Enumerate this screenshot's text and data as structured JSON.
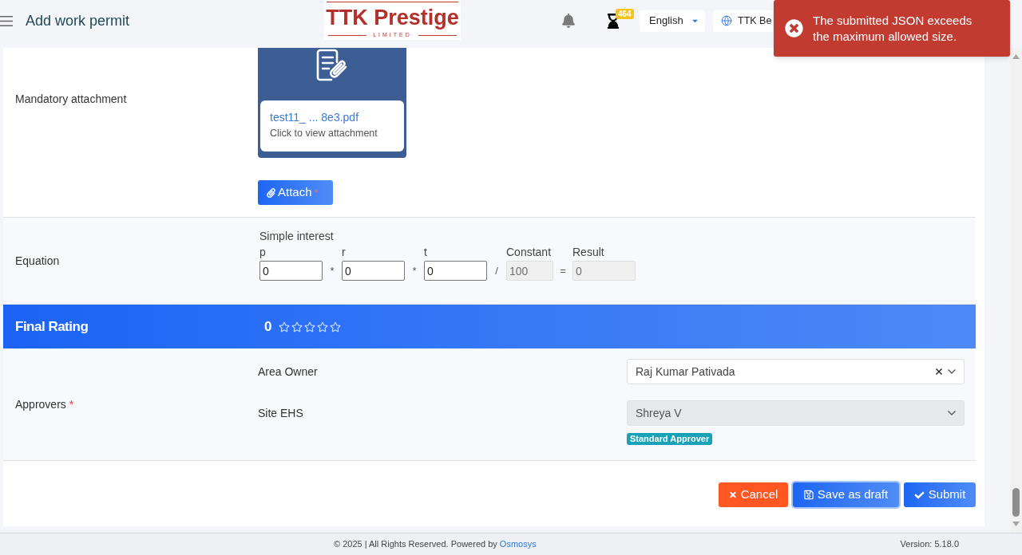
{
  "header": {
    "title": "Add work permit",
    "logo": {
      "name": "TTK Prestige",
      "tagline": "LIMITED"
    },
    "notification_badge": "464",
    "language": "English",
    "site": "TTK Be"
  },
  "toast": {
    "kind": "error",
    "message": "The submitted JSON exceeds the maximum allowed size."
  },
  "attachment": {
    "label": "Mandatory attachment",
    "file_name": "test11_ ... 8e3.pdf",
    "hint": "Click to view attachment",
    "button": "Attach",
    "required_mark": "*"
  },
  "equation": {
    "label": "Equation",
    "title": "Simple interest",
    "terms": [
      {
        "kind": "variable",
        "label": "p",
        "value": "0",
        "disabled": false,
        "operator": "*"
      },
      {
        "kind": "variable",
        "label": "r",
        "value": "0",
        "disabled": false,
        "operator": "*"
      },
      {
        "kind": "variable",
        "label": "t",
        "value": "0",
        "disabled": false,
        "operator": "/"
      },
      {
        "kind": "constant",
        "label": "Constant",
        "value": "100",
        "disabled": true,
        "operator": "="
      },
      {
        "kind": "result",
        "label": "Result",
        "value": "0",
        "disabled": true
      }
    ]
  },
  "final_rating": {
    "label": "Final Rating",
    "score": "0",
    "stars": 0
  },
  "approvers": {
    "label": "Approvers",
    "required_mark": "*",
    "rows": [
      {
        "role": "Area Owner",
        "value": "Raj Kumar Pativada",
        "disabled": false,
        "clearable": true
      },
      {
        "role": "Site EHS",
        "value": "Shreya V",
        "disabled": true,
        "clearable": false,
        "badge": "Standard Approver"
      }
    ]
  },
  "buttons": [
    {
      "kind": "cancel",
      "label": "Cancel",
      "focused": false
    },
    {
      "kind": "draft",
      "label": "Save as draft",
      "focused": true
    },
    {
      "kind": "submit",
      "label": "Submit",
      "focused": false
    }
  ],
  "footer": {
    "text": "© 2025 | All Rights Reserved. Powered by",
    "link": "Osmosys",
    "version": "Version: 5.18.0"
  }
}
